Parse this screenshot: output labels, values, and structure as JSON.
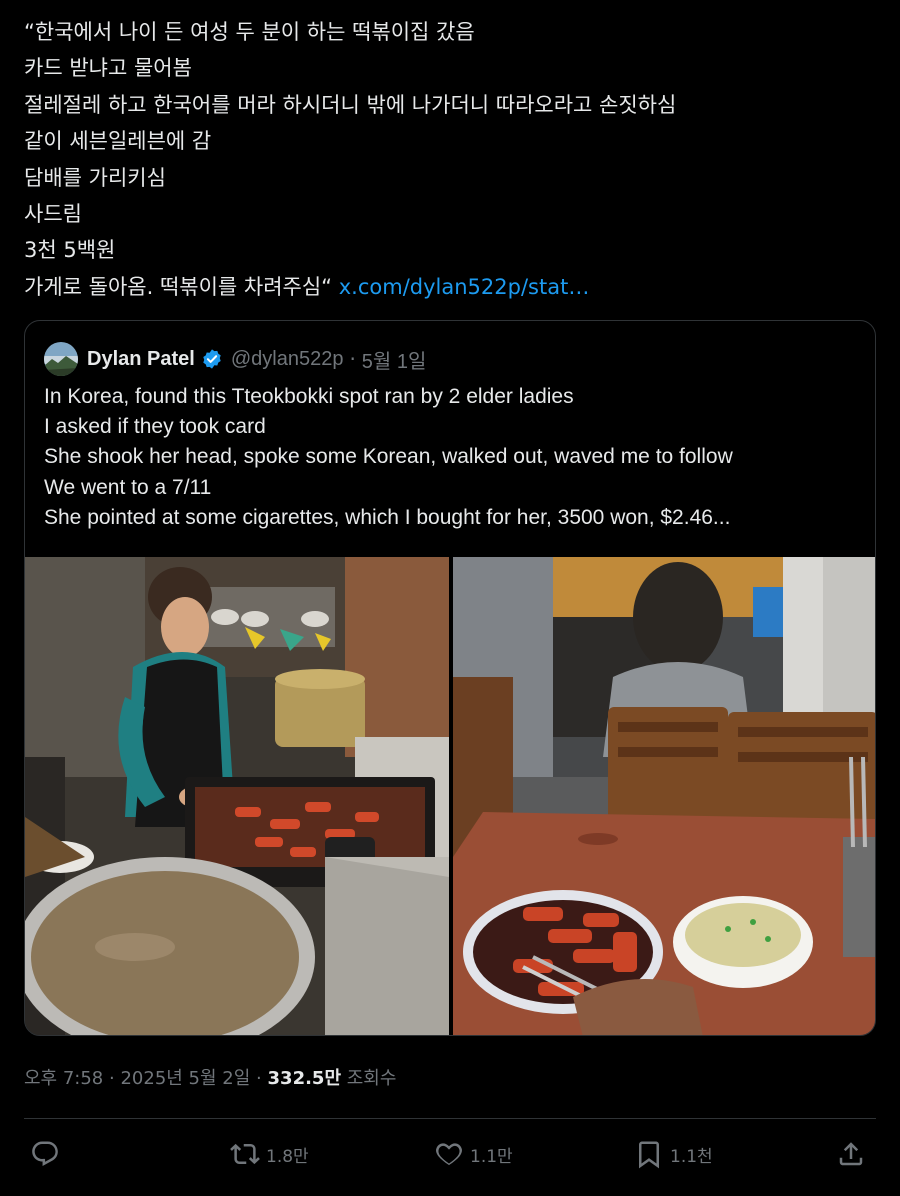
{
  "tweet": {
    "lines": [
      "“한국에서 나이 든 여성 두 분이 하는 떡볶이집 갔음",
      "카드 받냐고 물어봄",
      "절레절레 하고 한국어를 머라 하시더니 밖에 나가더니 따라오라고 손짓하심",
      "같이 세븐일레븐에 감",
      "담배를 가리키심",
      "사드림",
      "3천 5백원",
      "가게로 돌아옴. 떡볶이를 차려주심“"
    ],
    "link": "x.com/dylan522p/stat…"
  },
  "quote": {
    "author_name": "Dylan Patel",
    "handle": "@dylan522p",
    "separator": "·",
    "date": "5월 1일",
    "lines": [
      "In Korea, found this Tteokbokki spot ran by 2 elder ladies",
      "I asked if they took card",
      "She shook her head, spoke some Korean, walked out, waved me to follow",
      "We went to a 7/11",
      "She pointed at some cigarettes, which I bought for her, 3500 won, $2.46..."
    ],
    "photos": [
      {
        "icon": "photo-cooking-tteokbokki"
      },
      {
        "icon": "photo-tteokbokki-table"
      }
    ]
  },
  "meta": {
    "time": "오후 7:58",
    "sep1": "·",
    "date": "2025년 5월 2일",
    "sep2": "·",
    "views": "332.5만",
    "views_label": "조회수"
  },
  "actions": {
    "reply_count": "",
    "retweet_count": "1.8만",
    "like_count": "1.1만",
    "bookmark_count": "1.1천"
  },
  "colors": {
    "background": "#000000",
    "text": "#e7e9ea",
    "muted": "#71767b",
    "link": "#1d9bf0",
    "border": "#2f3336",
    "verified": "#1d9bf0"
  }
}
